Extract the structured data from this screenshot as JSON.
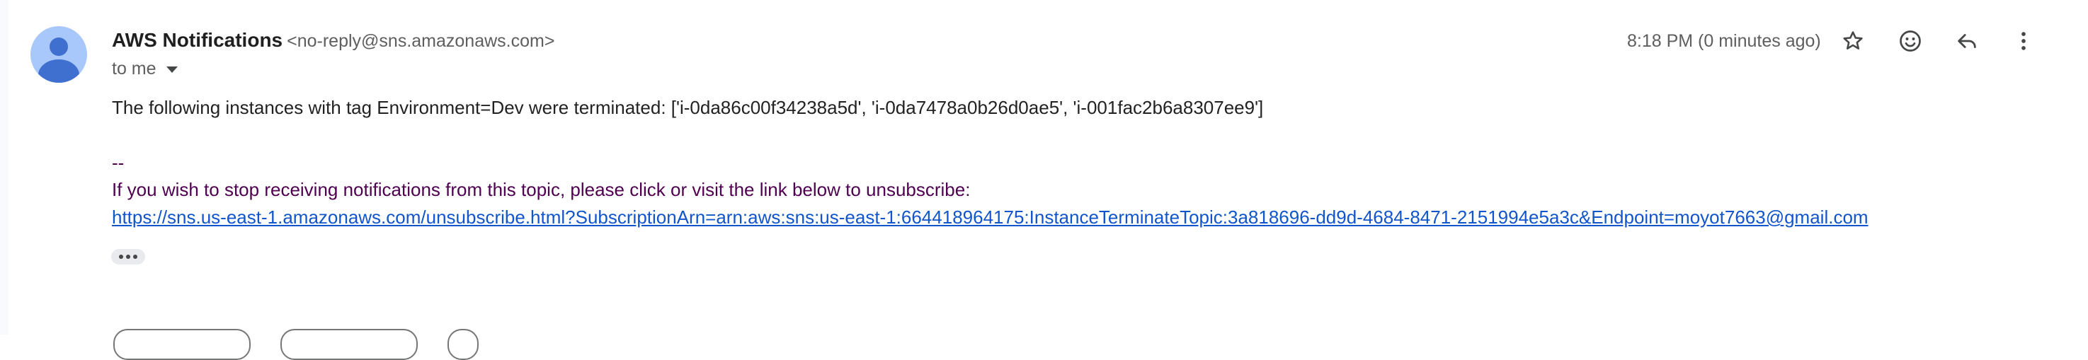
{
  "sender": {
    "name": "AWS Notifications",
    "email": "<no-reply@sns.amazonaws.com>"
  },
  "recipient": {
    "label": "to me"
  },
  "timestamp": "8:18 PM (0 minutes ago)",
  "toolbar": {
    "star_icon": "star-icon",
    "emoji_icon": "emoji-reaction-icon",
    "reply_icon": "reply-icon",
    "more_icon": "more-vert-icon"
  },
  "message": {
    "body": "The following instances with tag Environment=Dev were terminated: ['i-0da86c00f34238a5d', 'i-0da7478a0b26d0ae5', 'i-001fac2b6a8307ee9']",
    "signature_separator": "--",
    "unsubscribe_text": "If you wish to stop receiving notifications from this topic, please click or visit the link below to unsubscribe:",
    "unsubscribe_link": "https://sns.us-east-1.amazonaws.com/unsubscribe.html?SubscriptionArn=arn:aws:sns:us-east-1:664418964175:InstanceTerminateTopic:3a818696-dd9d-4684-8471-2151994e5a3c&Endpoint=moyot7663@gmail.com"
  },
  "colors": {
    "avatar_bg": "#a8c7fa",
    "avatar_fg": "#3f6fcf",
    "link": "#1155cc",
    "quoted_text": "#500050"
  }
}
